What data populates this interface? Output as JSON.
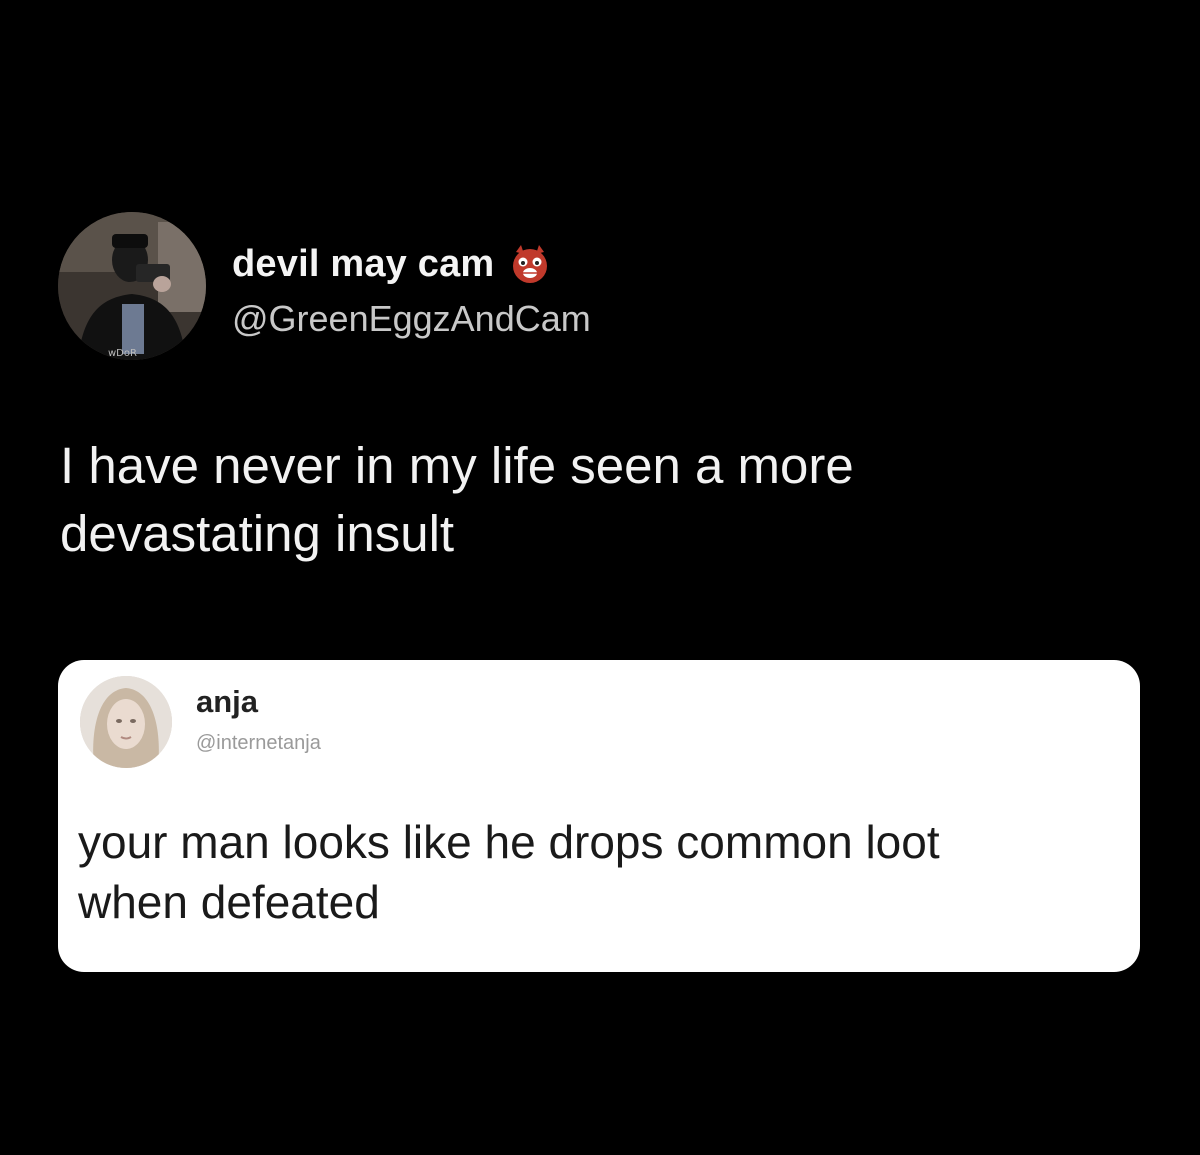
{
  "tweet": {
    "author": {
      "display_name": "devil may cam",
      "handle": "@GreenEggzAndCam",
      "name_emoji": "devil-face-emoji-icon"
    },
    "text": "I have never in my life seen a more\ndevastating insult"
  },
  "quoted_tweet": {
    "author": {
      "display_name": "anja",
      "handle": "@internetanja"
    },
    "text": "your man looks like he drops common loot\nwhen defeated"
  },
  "colors": {
    "background": "#000000",
    "card_background": "#ffffff",
    "primary_text": "#f2f2f2",
    "secondary_text": "#c8c8c8",
    "card_text": "#1a1a1a",
    "card_secondary_text": "#9a9a9a"
  }
}
